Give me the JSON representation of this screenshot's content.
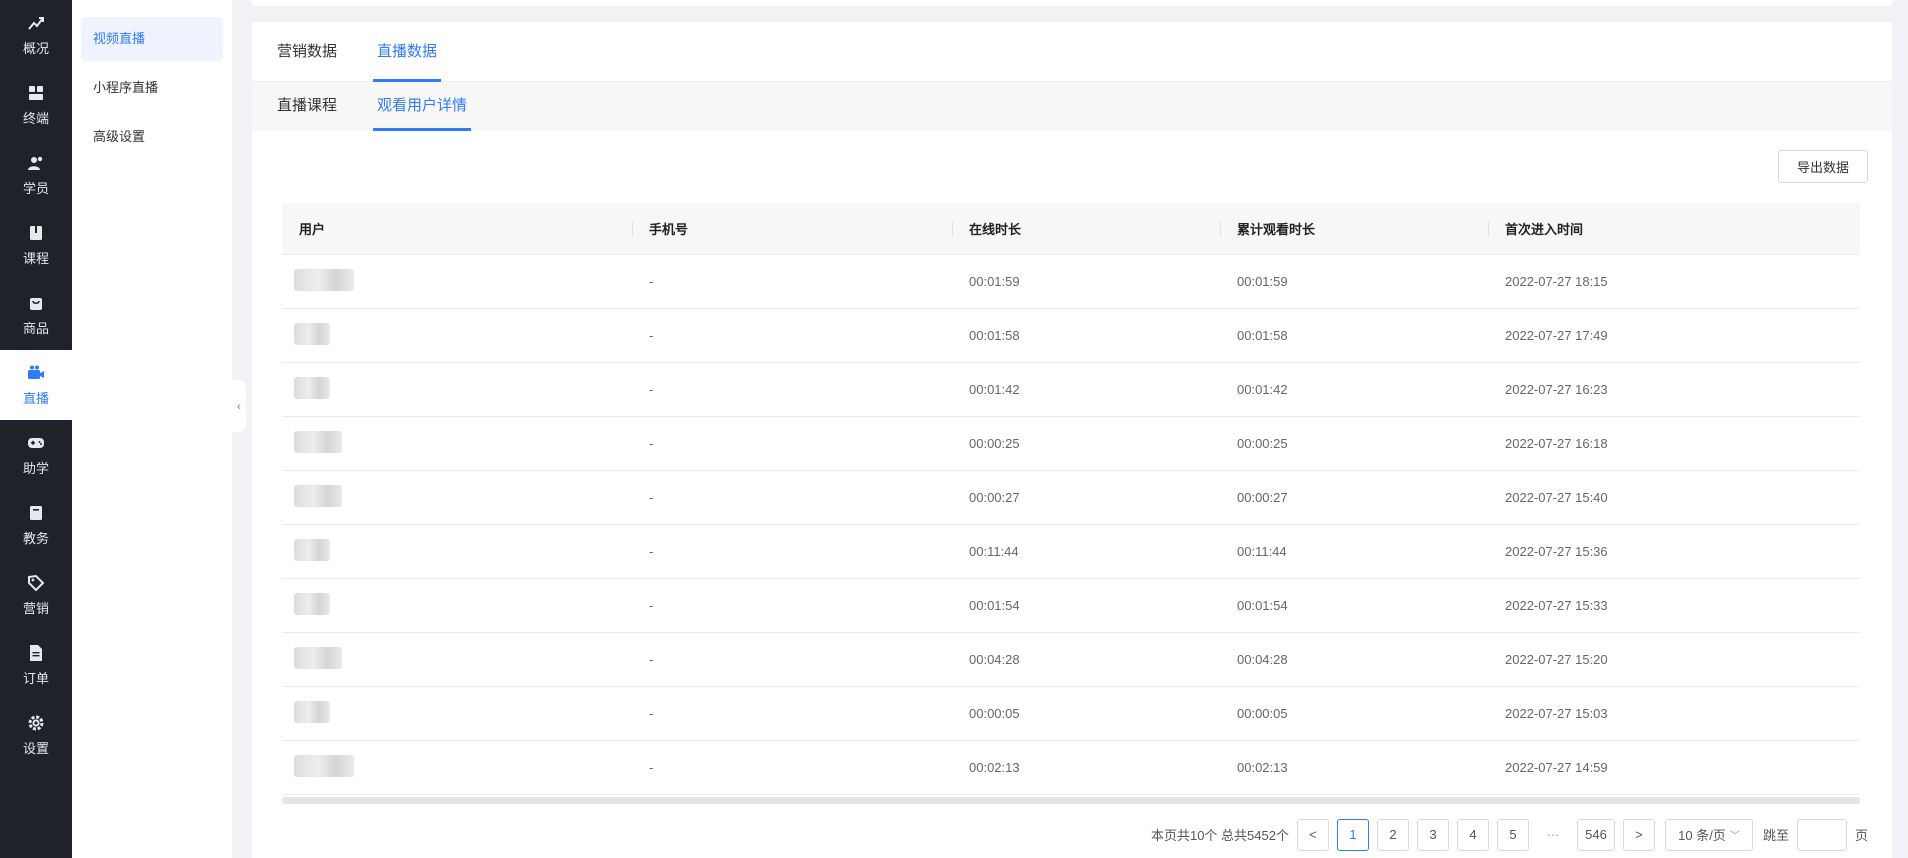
{
  "nav": {
    "items": [
      {
        "label": "概况",
        "icon": "chart-icon"
      },
      {
        "label": "终端",
        "icon": "store-icon"
      },
      {
        "label": "学员",
        "icon": "users-icon"
      },
      {
        "label": "课程",
        "icon": "book-icon"
      },
      {
        "label": "商品",
        "icon": "bag-icon"
      },
      {
        "label": "直播",
        "icon": "video-camera-icon"
      },
      {
        "label": "助学",
        "icon": "gamepad-icon"
      },
      {
        "label": "教务",
        "icon": "notebook-icon"
      },
      {
        "label": "营销",
        "icon": "tag-icon"
      },
      {
        "label": "订单",
        "icon": "document-icon"
      },
      {
        "label": "设置",
        "icon": "gear-icon"
      }
    ]
  },
  "subnav": {
    "items": [
      "视频直播",
      "小程序直播",
      "高级设置"
    ]
  },
  "tabs": [
    "营销数据",
    "直播数据"
  ],
  "subtabs": [
    "直播课程",
    "观看用户详情"
  ],
  "export_label": "导出数据",
  "table": {
    "columns": [
      "用户",
      "手机号",
      "在线时长",
      "累计观看时长",
      "首次进入时间"
    ],
    "rows": [
      {
        "phone": "-",
        "online": "00:01:59",
        "total": "00:01:59",
        "first": "2022-07-27 18:15"
      },
      {
        "phone": "-",
        "online": "00:01:58",
        "total": "00:01:58",
        "first": "2022-07-27 17:49"
      },
      {
        "phone": "-",
        "online": "00:01:42",
        "total": "00:01:42",
        "first": "2022-07-27 16:23"
      },
      {
        "phone": "-",
        "online": "00:00:25",
        "total": "00:00:25",
        "first": "2022-07-27 16:18"
      },
      {
        "phone": "-",
        "online": "00:00:27",
        "total": "00:00:27",
        "first": "2022-07-27 15:40"
      },
      {
        "phone": "-",
        "online": "00:11:44",
        "total": "00:11:44",
        "first": "2022-07-27 15:36"
      },
      {
        "phone": "-",
        "online": "00:01:54",
        "total": "00:01:54",
        "first": "2022-07-27 15:33"
      },
      {
        "phone": "-",
        "online": "00:04:28",
        "total": "00:04:28",
        "first": "2022-07-27 15:20"
      },
      {
        "phone": "-",
        "online": "00:00:05",
        "total": "00:00:05",
        "first": "2022-07-27 15:03"
      },
      {
        "phone": "-",
        "online": "00:02:13",
        "total": "00:02:13",
        "first": "2022-07-27 14:59"
      }
    ]
  },
  "pagination": {
    "summary": "本页共10个 总共5452个",
    "prev": "<",
    "pages": [
      "1",
      "2",
      "3",
      "4",
      "5"
    ],
    "dots": "···",
    "last": "546",
    "next": ">",
    "page_size": "10 条/页",
    "jump_label": "跳至",
    "page_suffix": "页"
  }
}
